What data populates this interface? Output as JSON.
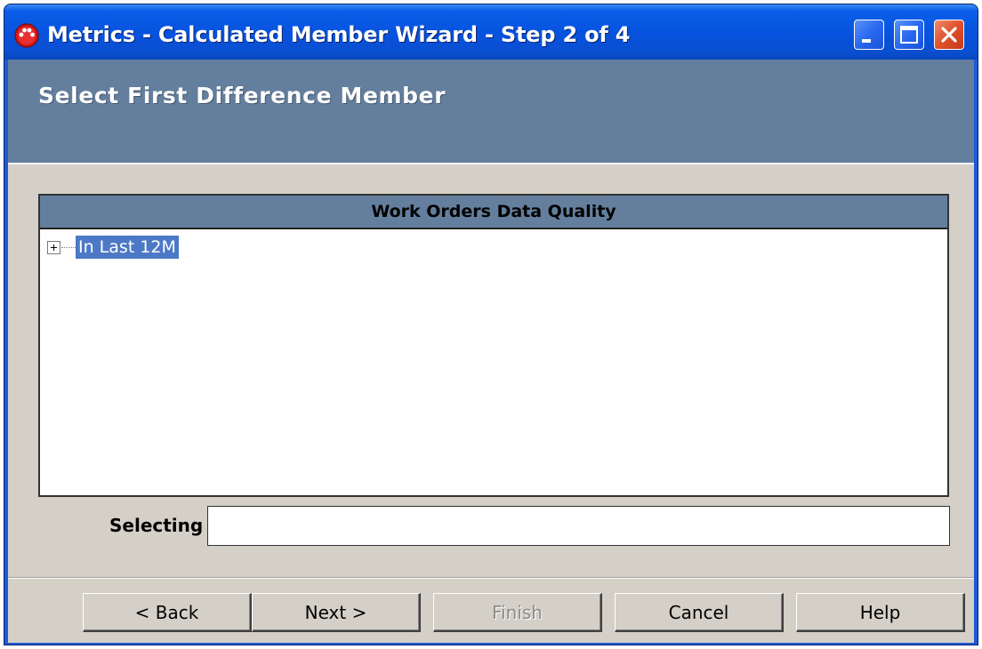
{
  "window": {
    "title": "Metrics - Calculated Member Wizard - Step 2 of 4",
    "controls": [
      "minimize-icon",
      "maximize-icon",
      "close-icon"
    ]
  },
  "header": {
    "title": "Select First Difference Member"
  },
  "tree": {
    "header": "Work Orders Data Quality",
    "items": [
      {
        "label": "In Last 12M",
        "selected": true,
        "expander": "plus-icon"
      }
    ]
  },
  "selecting": {
    "label": "Selecting",
    "value": ""
  },
  "buttons": {
    "back": "< Back",
    "next": "Next >",
    "finish": "Finish",
    "cancel": "Cancel",
    "help": "Help"
  },
  "colors": {
    "title_bar": "#0753DF",
    "header_band": "#647F9D",
    "selection": "#4C78C6",
    "dialog_bg": "#D4D0C8"
  }
}
